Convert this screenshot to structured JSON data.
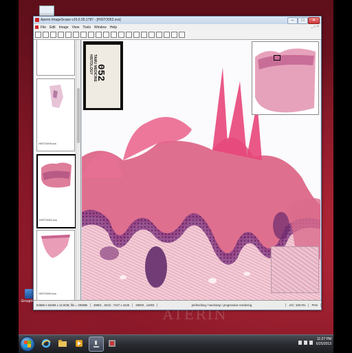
{
  "window": {
    "title": "Aperio ImageScope v10.0.35.1787 - [HISTO052.svs]",
    "controls": {
      "minimize": "–",
      "maximize": "□",
      "close": "✕"
    }
  },
  "menu": {
    "items": [
      "File",
      "Edit",
      "Image",
      "View",
      "Tools",
      "Window",
      "Help"
    ],
    "right_text": "_ □ ×"
  },
  "toolbar": {
    "icons": [
      "open-icon",
      "open-folder-icon",
      "save-icon",
      "print-icon",
      "home-icon",
      "back-icon",
      "forward-icon",
      "up-icon",
      "magnifier-icon",
      "pan-icon",
      "lens-icon",
      "zoom-icon",
      "rotate-icon",
      "arrow-icon",
      "pen-icon",
      "rectangle-icon",
      "ellipse-icon",
      "ruler-icon",
      "color-icon",
      "grid-icon"
    ]
  },
  "thumbnails": [
    {
      "caption": ""
    },
    {
      "caption": "HISTO009.svs"
    },
    {
      "caption": "HISTO052.svs",
      "selected": true
    },
    {
      "caption": "HISTO050.svs"
    }
  ],
  "slide_label": {
    "number": "052",
    "line1": "TAMU MEDICINE",
    "line2": "HISTOLOGY"
  },
  "status": {
    "size": "84588 x 53269 x 12.6GB, file = 293MB",
    "coords": "28601 , 8215 : 7447 x 4425",
    "pos": "28000 , 11003",
    "message": "prefetching / trackmap / progressive rendering",
    "zoom": "A/C: 100.0%",
    "mode": "PAN"
  },
  "desktop": {
    "icon_label": "GroupWise",
    "watermark": "ATERIN"
  },
  "taskbar": {
    "time": "11:27 PM",
    "date": "6/25/2013"
  },
  "colors": {
    "desktop": "#7a1524",
    "tissue_pink": "#e0607f",
    "tissue_purple": "#6b2a6d",
    "stroma": "#f2c7d2"
  }
}
